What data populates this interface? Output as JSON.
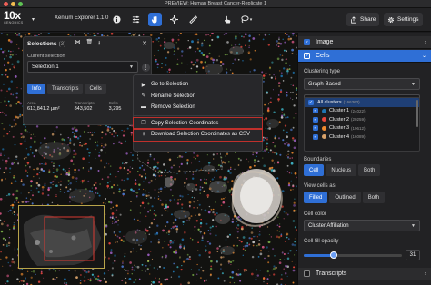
{
  "window": {
    "title": "PREVIEW: Human Breast Cancer-Replicate 1"
  },
  "toolbar": {
    "logo_big": "10x",
    "logo_small": "GENOMICS",
    "app_name": "Xenium Explorer 1.1.0",
    "share_label": "Share",
    "settings_label": "Settings"
  },
  "selections": {
    "title": "Selections",
    "count": "(3)",
    "current_label": "Current selection",
    "current_value": "Selection 1",
    "tabs": [
      "Info",
      "Transcripts",
      "Cells"
    ],
    "stats": [
      {
        "key": "Area",
        "value": "613,841.2 µm²"
      },
      {
        "key": "Transcripts",
        "value": "843,502"
      },
      {
        "key": "Cells",
        "value": "3,295"
      }
    ]
  },
  "context_menu": {
    "items": [
      {
        "label": "Go to Selection",
        "icon": "play-icon"
      },
      {
        "label": "Rename Selection",
        "icon": "pencil-icon"
      },
      {
        "label": "Remove Selection",
        "icon": "trash-icon"
      },
      {
        "label": "Copy Selection Coordinates",
        "icon": "copy-icon",
        "highlighted": true
      },
      {
        "label": "Download Selection Coordinates as CSV",
        "icon": "download-icon",
        "highlighted": true
      }
    ]
  },
  "right_panel": {
    "image_label": "Image",
    "cells_label": "Cells",
    "clustering_type_label": "Clustering type",
    "clustering_type_value": "Graph-Based",
    "clusters": [
      {
        "label": "All clusters",
        "count": "(166363)",
        "color": ""
      },
      {
        "label": "Cluster 1",
        "count": "(24022)",
        "color": "#1f77b4"
      },
      {
        "label": "Cluster 2",
        "count": "(20259)",
        "color": "#e8463c"
      },
      {
        "label": "Cluster 3",
        "count": "(19612)",
        "color": "#ef8a2e"
      },
      {
        "label": "Cluster 4",
        "count": "(16089)",
        "color": "#d9a26a"
      }
    ],
    "boundaries_label": "Boundaries",
    "boundaries_options": [
      "Cell",
      "Nucleus",
      "Both"
    ],
    "view_cells_label": "View cells as",
    "view_cells_options": [
      "Filled",
      "Outlined",
      "Both"
    ],
    "cell_color_label": "Cell color",
    "cell_color_value": "Cluster Affiliation",
    "fill_opacity_label": "Cell fill opacity",
    "fill_opacity_value": "31",
    "fill_opacity_fraction": 0.31,
    "transcripts_label": "Transcripts"
  },
  "colors": {
    "accent": "#2f6fd6",
    "highlight_box": "#c0302c",
    "minimap_border": "#b8a44a"
  }
}
